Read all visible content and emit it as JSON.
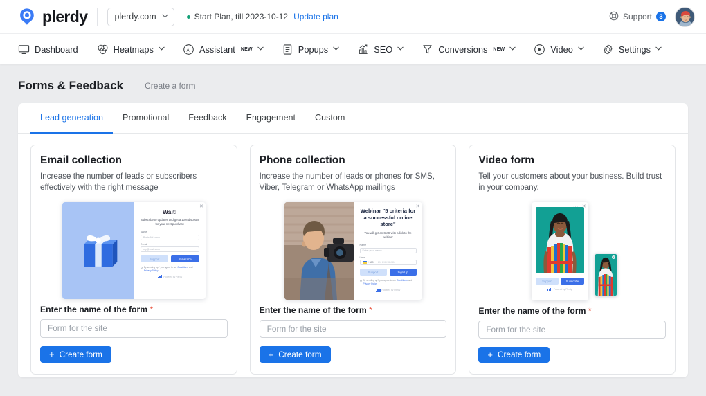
{
  "header": {
    "brand": "plerdy",
    "domain_selector": {
      "value": "plerdy.com",
      "icon": "chevron-down-icon"
    },
    "plan_text": "Start Plan, till 2023-10-12",
    "update_plan_link": "Update plan",
    "support_label": "Support",
    "support_count": "3",
    "support_icon": "lifebuoy-icon",
    "avatar_alt": "user-avatar",
    "accent_blue": "#1a73e8",
    "status_green": "#14a077"
  },
  "nav": {
    "items": [
      {
        "label": "Dashboard",
        "icon": "monitor-icon",
        "caret": false,
        "badge": ""
      },
      {
        "label": "Heatmaps",
        "icon": "venn-circles-icon",
        "caret": true,
        "badge": ""
      },
      {
        "label": "Assistant",
        "icon": "ai-circle-icon",
        "caret": true,
        "badge": "NEW"
      },
      {
        "label": "Popups",
        "icon": "document-lines-icon",
        "caret": true,
        "badge": ""
      },
      {
        "label": "SEO",
        "icon": "bar-chart-arrow-icon",
        "caret": true,
        "badge": ""
      },
      {
        "label": "Conversions",
        "icon": "funnel-icon",
        "caret": true,
        "badge": "NEW"
      },
      {
        "label": "Video",
        "icon": "play-circle-icon",
        "caret": true,
        "badge": ""
      },
      {
        "label": "Settings",
        "icon": "gear-icon",
        "caret": true,
        "badge": ""
      }
    ]
  },
  "page": {
    "title": "Forms & Feedback",
    "breadcrumb": "Create a form"
  },
  "tabs": [
    {
      "label": "Lead generation",
      "active": true
    },
    {
      "label": "Promotional",
      "active": false
    },
    {
      "label": "Feedback",
      "active": false
    },
    {
      "label": "Engagement",
      "active": false
    },
    {
      "label": "Custom",
      "active": false
    }
  ],
  "cards": [
    {
      "title": "Email collection",
      "description": "Increase the number of leads or subscribers effectively with the right message",
      "field_label": "Enter the name of the form",
      "required_mark": "*",
      "input_placeholder": "Form for the site",
      "input_value": "",
      "button_label": "Create form",
      "button_icon": "plus-icon",
      "preview": {
        "close_icon": "close-icon",
        "heading": "Wait!",
        "subheading": "Subscribe to updates and get a 10% discount for your next purchase",
        "fields": [
          {
            "label": "Name",
            "placeholder": "Boris Johnson"
          },
          {
            "label": "E-mail",
            "placeholder": "my@mail.com"
          }
        ],
        "secondary_button": "Support",
        "primary_button": "Subscribe",
        "legal_prefix": "By sending up? you agree to our",
        "legal_link1": "Conditions",
        "legal_and": "and",
        "legal_link2": "Privacy Policy",
        "powered_by": "Powered by Plerdy",
        "image_alt": "blue-gift-box-illustration"
      }
    },
    {
      "title": "Phone collection",
      "description": "Increase the number of leads or phones for SMS, Viber, Telegram or WhatsApp mailings",
      "field_label": "Enter the name of the form",
      "required_mark": "*",
      "input_placeholder": "Form for the site",
      "input_value": "",
      "button_label": "Create form",
      "button_icon": "plus-icon",
      "preview": {
        "close_icon": "close-icon",
        "heading": "Webinar \"5 criteria for a successful online store\"",
        "subheading": "You will get an SMS with a link to the webinar",
        "fields": [
          {
            "label": "Name",
            "placeholder": "Enter your name"
          },
          {
            "label": "Links",
            "placeholder": "XX XXX XXXX",
            "country_code": "+380"
          }
        ],
        "secondary_button": "Support",
        "primary_button": "Sign Up",
        "legal_prefix": "By sending up? you agree to our",
        "legal_link1": "Conditions",
        "legal_and": "and",
        "legal_link2": "Privacy Policy",
        "powered_by": "Powered by Plerdy",
        "image_alt": "man-with-video-camera-photo"
      }
    },
    {
      "title": "Video form",
      "description": "Tell your customers about your business. Build trust in your company.",
      "field_label": "Enter the name of the form",
      "required_mark": "*",
      "input_placeholder": "Form for the site",
      "input_value": "",
      "button_label": "Create form",
      "button_icon": "plus-icon",
      "preview": {
        "close_icon": "close-icon",
        "menu_icon": "dots-icon",
        "secondary_button": "Support",
        "primary_button": "Subscribe",
        "powered_by": "Powered by Plerdy",
        "image_alt": "woman-in-colorful-striped-outfit-photo",
        "thumb_alt": "video-thumbnail-preview"
      }
    }
  ]
}
